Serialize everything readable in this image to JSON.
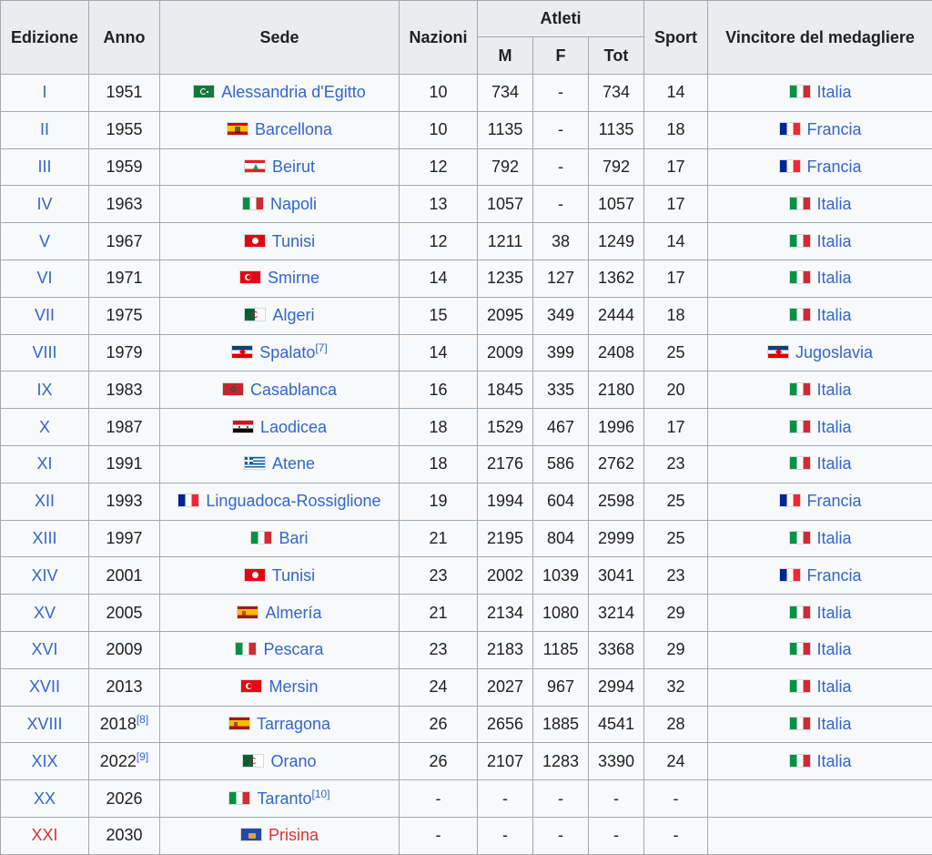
{
  "headers": {
    "edizione": "Edizione",
    "anno": "Anno",
    "sede": "Sede",
    "nazioni": "Nazioni",
    "atleti": "Atleti",
    "m": "M",
    "f": "F",
    "tot": "Tot",
    "sport": "Sport",
    "vincitore": "Vincitore del medagliere"
  },
  "rows": [
    {
      "ed": "I",
      "anno": "1951",
      "anno_ref": "",
      "sede": "Alessandria d'Egitto",
      "sede_ref": "",
      "sede_flag": "egypt-1951-flag",
      "naz": "10",
      "m": "734",
      "f": "-",
      "tot": "734",
      "sport": "14",
      "win": "Italia",
      "win_flag": "italy-flag",
      "red": false
    },
    {
      "ed": "II",
      "anno": "1955",
      "anno_ref": "",
      "sede": "Barcellona",
      "sede_ref": "",
      "sede_flag": "spain-1945-flag",
      "naz": "10",
      "m": "1135",
      "f": "-",
      "tot": "1135",
      "sport": "18",
      "win": "Francia",
      "win_flag": "france-flag",
      "red": false
    },
    {
      "ed": "III",
      "anno": "1959",
      "anno_ref": "",
      "sede": "Beirut",
      "sede_ref": "",
      "sede_flag": "lebanon-flag",
      "naz": "12",
      "m": "792",
      "f": "-",
      "tot": "792",
      "sport": "17",
      "win": "Francia",
      "win_flag": "france-flag",
      "red": false
    },
    {
      "ed": "IV",
      "anno": "1963",
      "anno_ref": "",
      "sede": "Napoli",
      "sede_ref": "",
      "sede_flag": "italy-flag",
      "naz": "13",
      "m": "1057",
      "f": "-",
      "tot": "1057",
      "sport": "17",
      "win": "Italia",
      "win_flag": "italy-flag",
      "red": false
    },
    {
      "ed": "V",
      "anno": "1967",
      "anno_ref": "",
      "sede": "Tunisi",
      "sede_ref": "",
      "sede_flag": "tunisia-flag",
      "naz": "12",
      "m": "1211",
      "f": "38",
      "tot": "1249",
      "sport": "14",
      "win": "Italia",
      "win_flag": "italy-flag",
      "red": false
    },
    {
      "ed": "VI",
      "anno": "1971",
      "anno_ref": "",
      "sede": "Smirne",
      "sede_ref": "",
      "sede_flag": "turkey-flag",
      "naz": "14",
      "m": "1235",
      "f": "127",
      "tot": "1362",
      "sport": "17",
      "win": "Italia",
      "win_flag": "italy-flag",
      "red": false
    },
    {
      "ed": "VII",
      "anno": "1975",
      "anno_ref": "",
      "sede": "Algeri",
      "sede_ref": "",
      "sede_flag": "algeria-flag",
      "naz": "15",
      "m": "2095",
      "f": "349",
      "tot": "2444",
      "sport": "18",
      "win": "Italia",
      "win_flag": "italy-flag",
      "red": false
    },
    {
      "ed": "VIII",
      "anno": "1979",
      "anno_ref": "",
      "sede": "Spalato",
      "sede_ref": "[7]",
      "sede_flag": "yugoslavia-flag",
      "naz": "14",
      "m": "2009",
      "f": "399",
      "tot": "2408",
      "sport": "25",
      "win": "Jugoslavia",
      "win_flag": "yugoslavia-flag",
      "red": false
    },
    {
      "ed": "IX",
      "anno": "1983",
      "anno_ref": "",
      "sede": "Casablanca",
      "sede_ref": "",
      "sede_flag": "morocco-flag",
      "naz": "16",
      "m": "1845",
      "f": "335",
      "tot": "2180",
      "sport": "20",
      "win": "Italia",
      "win_flag": "italy-flag",
      "red": false
    },
    {
      "ed": "X",
      "anno": "1987",
      "anno_ref": "",
      "sede": "Laodicea",
      "sede_ref": "",
      "sede_flag": "syria-flag",
      "naz": "18",
      "m": "1529",
      "f": "467",
      "tot": "1996",
      "sport": "17",
      "win": "Italia",
      "win_flag": "italy-flag",
      "red": false
    },
    {
      "ed": "XI",
      "anno": "1991",
      "anno_ref": "",
      "sede": "Atene",
      "sede_ref": "",
      "sede_flag": "greece-flag",
      "naz": "18",
      "m": "2176",
      "f": "586",
      "tot": "2762",
      "sport": "23",
      "win": "Italia",
      "win_flag": "italy-flag",
      "red": false
    },
    {
      "ed": "XII",
      "anno": "1993",
      "anno_ref": "",
      "sede": "Linguadoca-Rossiglione",
      "sede_ref": "",
      "sede_flag": "france-flag",
      "naz": "19",
      "m": "1994",
      "f": "604",
      "tot": "2598",
      "sport": "25",
      "win": "Francia",
      "win_flag": "france-flag",
      "red": false
    },
    {
      "ed": "XIII",
      "anno": "1997",
      "anno_ref": "",
      "sede": "Bari",
      "sede_ref": "",
      "sede_flag": "italy-flag",
      "naz": "21",
      "m": "2195",
      "f": "804",
      "tot": "2999",
      "sport": "25",
      "win": "Italia",
      "win_flag": "italy-flag",
      "red": false
    },
    {
      "ed": "XIV",
      "anno": "2001",
      "anno_ref": "",
      "sede": "Tunisi",
      "sede_ref": "",
      "sede_flag": "tunisia-flag",
      "naz": "23",
      "m": "2002",
      "f": "1039",
      "tot": "3041",
      "sport": "23",
      "win": "Francia",
      "win_flag": "france-flag",
      "red": false
    },
    {
      "ed": "XV",
      "anno": "2005",
      "anno_ref": "",
      "sede": "Almería",
      "sede_ref": "",
      "sede_flag": "spain-flag",
      "naz": "21",
      "m": "2134",
      "f": "1080",
      "tot": "3214",
      "sport": "29",
      "win": "Italia",
      "win_flag": "italy-flag",
      "red": false
    },
    {
      "ed": "XVI",
      "anno": "2009",
      "anno_ref": "",
      "sede": "Pescara",
      "sede_ref": "",
      "sede_flag": "italy-flag",
      "naz": "23",
      "m": "2183",
      "f": "1185",
      "tot": "3368",
      "sport": "29",
      "win": "Italia",
      "win_flag": "italy-flag",
      "red": false
    },
    {
      "ed": "XVII",
      "anno": "2013",
      "anno_ref": "",
      "sede": "Mersin",
      "sede_ref": "",
      "sede_flag": "turkey-flag",
      "naz": "24",
      "m": "2027",
      "f": "967",
      "tot": "2994",
      "sport": "32",
      "win": "Italia",
      "win_flag": "italy-flag",
      "red": false
    },
    {
      "ed": "XVIII",
      "anno": "2018",
      "anno_ref": "[8]",
      "sede": "Tarragona",
      "sede_ref": "",
      "sede_flag": "spain-flag",
      "naz": "26",
      "m": "2656",
      "f": "1885",
      "tot": "4541",
      "sport": "28",
      "win": "Italia",
      "win_flag": "italy-flag",
      "red": false
    },
    {
      "ed": "XIX",
      "anno": "2022",
      "anno_ref": "[9]",
      "sede": "Orano",
      "sede_ref": "",
      "sede_flag": "algeria-flag",
      "naz": "26",
      "m": "2107",
      "f": "1283",
      "tot": "3390",
      "sport": "24",
      "win": "Italia",
      "win_flag": "italy-flag",
      "red": false
    },
    {
      "ed": "XX",
      "anno": "2026",
      "anno_ref": "",
      "sede": "Taranto",
      "sede_ref": "[10]",
      "sede_flag": "italy-flag",
      "naz": "-",
      "m": "-",
      "f": "-",
      "tot": "-",
      "sport": "-",
      "win": "",
      "win_flag": "",
      "red": false
    },
    {
      "ed": "XXI",
      "anno": "2030",
      "anno_ref": "",
      "sede": "Prisina",
      "sede_ref": "",
      "sede_flag": "kosovo-flag",
      "naz": "-",
      "m": "-",
      "f": "-",
      "tot": "-",
      "sport": "-",
      "win": "",
      "win_flag": "",
      "red": true
    }
  ],
  "colors": {
    "link": "#3366cc",
    "redlink": "#d73333",
    "header_bg": "#eaecf0",
    "cell_bg": "#f8f9fa",
    "border": "#a2a9b1"
  }
}
